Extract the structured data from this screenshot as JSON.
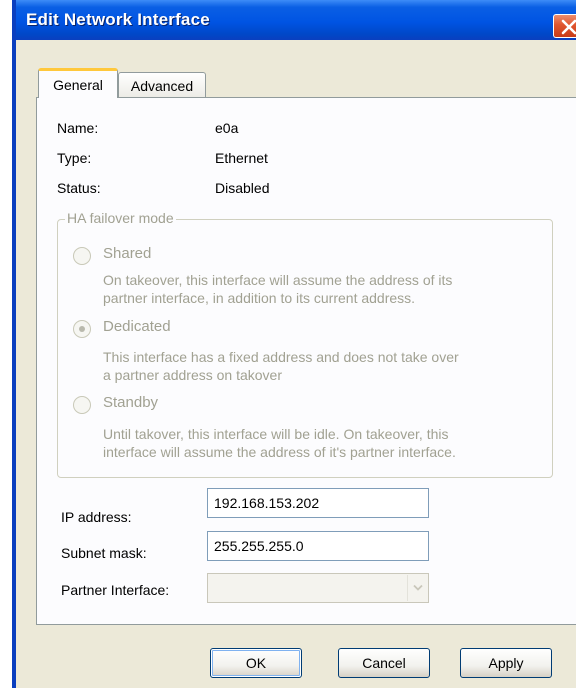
{
  "window": {
    "title": "Edit Network Interface"
  },
  "tabs": [
    {
      "label": "General",
      "active": true
    },
    {
      "label": "Advanced",
      "active": false
    }
  ],
  "info": {
    "name_label": "Name:",
    "name_value": "e0a",
    "type_label": "Type:",
    "type_value": "Ethernet",
    "status_label": "Status:",
    "status_value": "Disabled"
  },
  "ha_group": {
    "title": "HA failover mode",
    "enabled": false,
    "options": [
      {
        "label": "Shared",
        "selected": false,
        "desc1": "On takeover, this interface will assume the address of its",
        "desc2": "partner interface, in addition to its current address."
      },
      {
        "label": "Dedicated",
        "selected": true,
        "desc1": "This interface has a fixed address and does not take over",
        "desc2": "a partner address on takover"
      },
      {
        "label": "Standby",
        "selected": false,
        "desc1": "Until takover, this interface will be idle. On takeover, this",
        "desc2": "interface will assume the address of it's partner interface."
      }
    ]
  },
  "fields": {
    "ip_label": "IP address:",
    "ip_value": "192.168.153.202",
    "mask_label": "Subnet mask:",
    "mask_value": "255.255.255.0",
    "partner_label": "Partner Interface:",
    "partner_value": ""
  },
  "buttons": {
    "ok": "OK",
    "cancel": "Cancel",
    "apply": "Apply"
  },
  "colors": {
    "titlebar": "#0054e3",
    "dialog_bg": "#ece9d8",
    "disabled_text": "#a1a192",
    "active_tab_highlight": "#ffc83c"
  },
  "icons": {
    "close": "close-icon",
    "dropdown": "chevron-down-icon"
  }
}
